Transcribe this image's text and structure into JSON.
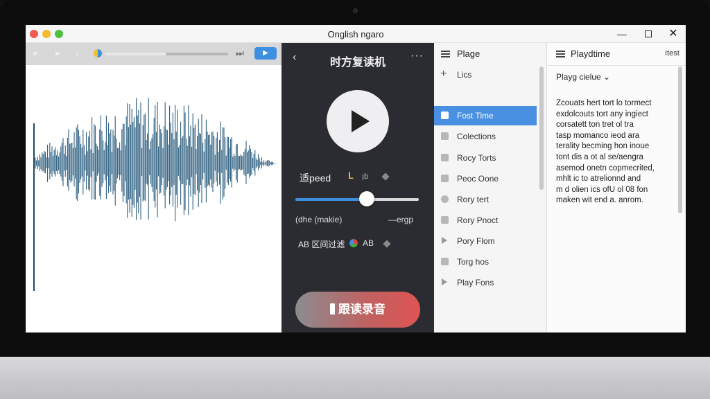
{
  "window": {
    "title": "Onglish ngaro",
    "minimize_glyph": "—",
    "close_glyph": "✕"
  },
  "transport": {
    "rewind_glyph": "«",
    "forward_glyph": "»",
    "skip_glyph": "›",
    "end_glyph": "⏭",
    "play_glyph": "▶",
    "progress": 0.5
  },
  "player": {
    "back_glyph": "‹",
    "title": "时方复读机",
    "more_glyph": "···",
    "speed_label": "适peed",
    "speed_icon_label": "𝐋",
    "speed_icon2_label": "ꞁb",
    "speed_value": 0.58,
    "slider_left_label": "(dhe (makie)",
    "slider_right_label": "—ergp",
    "ab_label": "AB 区间过滤",
    "ab_label_2": "AB",
    "record_label": "跟读录音"
  },
  "list_pane": {
    "title": "Plage",
    "items": [
      {
        "label": "Lics",
        "icon": "plus-icon"
      },
      {
        "label": "Fost Time",
        "icon": "doc-icon",
        "selected": true
      },
      {
        "label": "Colections",
        "icon": "folder-icon"
      },
      {
        "label": "Rocy Torts",
        "icon": "square-icon"
      },
      {
        "label": "Peoc Oone",
        "icon": "square-icon"
      },
      {
        "label": "Rory tert",
        "icon": "circle-icon"
      },
      {
        "label": "Rory Pnoct",
        "icon": "square-icon"
      },
      {
        "label": "Pory Flom",
        "icon": "speaker-icon"
      },
      {
        "label": "Torg hos",
        "icon": "doc-icon"
      },
      {
        "label": "Play Fons",
        "icon": "play-icon"
      }
    ]
  },
  "text_pane": {
    "title": "Playdtime",
    "right_label": "Itest",
    "dropdown_label": "Playg cielue ⌄",
    "body_lines": [
      "Zcouats hert tort lo tormect",
      "exdolcouts tort any ingiect",
      "corsatett ton tret ol tra",
      "tasp momanco ieod ara",
      "terality becming hon inoue",
      "tont dis a ot al se/aengra",
      "asemod onetn copmecrited,",
      "mhlt ic to atrelionnd and",
      "m d olien ics ofU ol 08 fon",
      "maken wit end a. anrom."
    ]
  },
  "colors": {
    "accent": "#3d8fe0",
    "waveform": "#2e5f80",
    "record_red": "#e05454",
    "player_bg": "#2a2c31",
    "selection": "#4a90e2"
  }
}
